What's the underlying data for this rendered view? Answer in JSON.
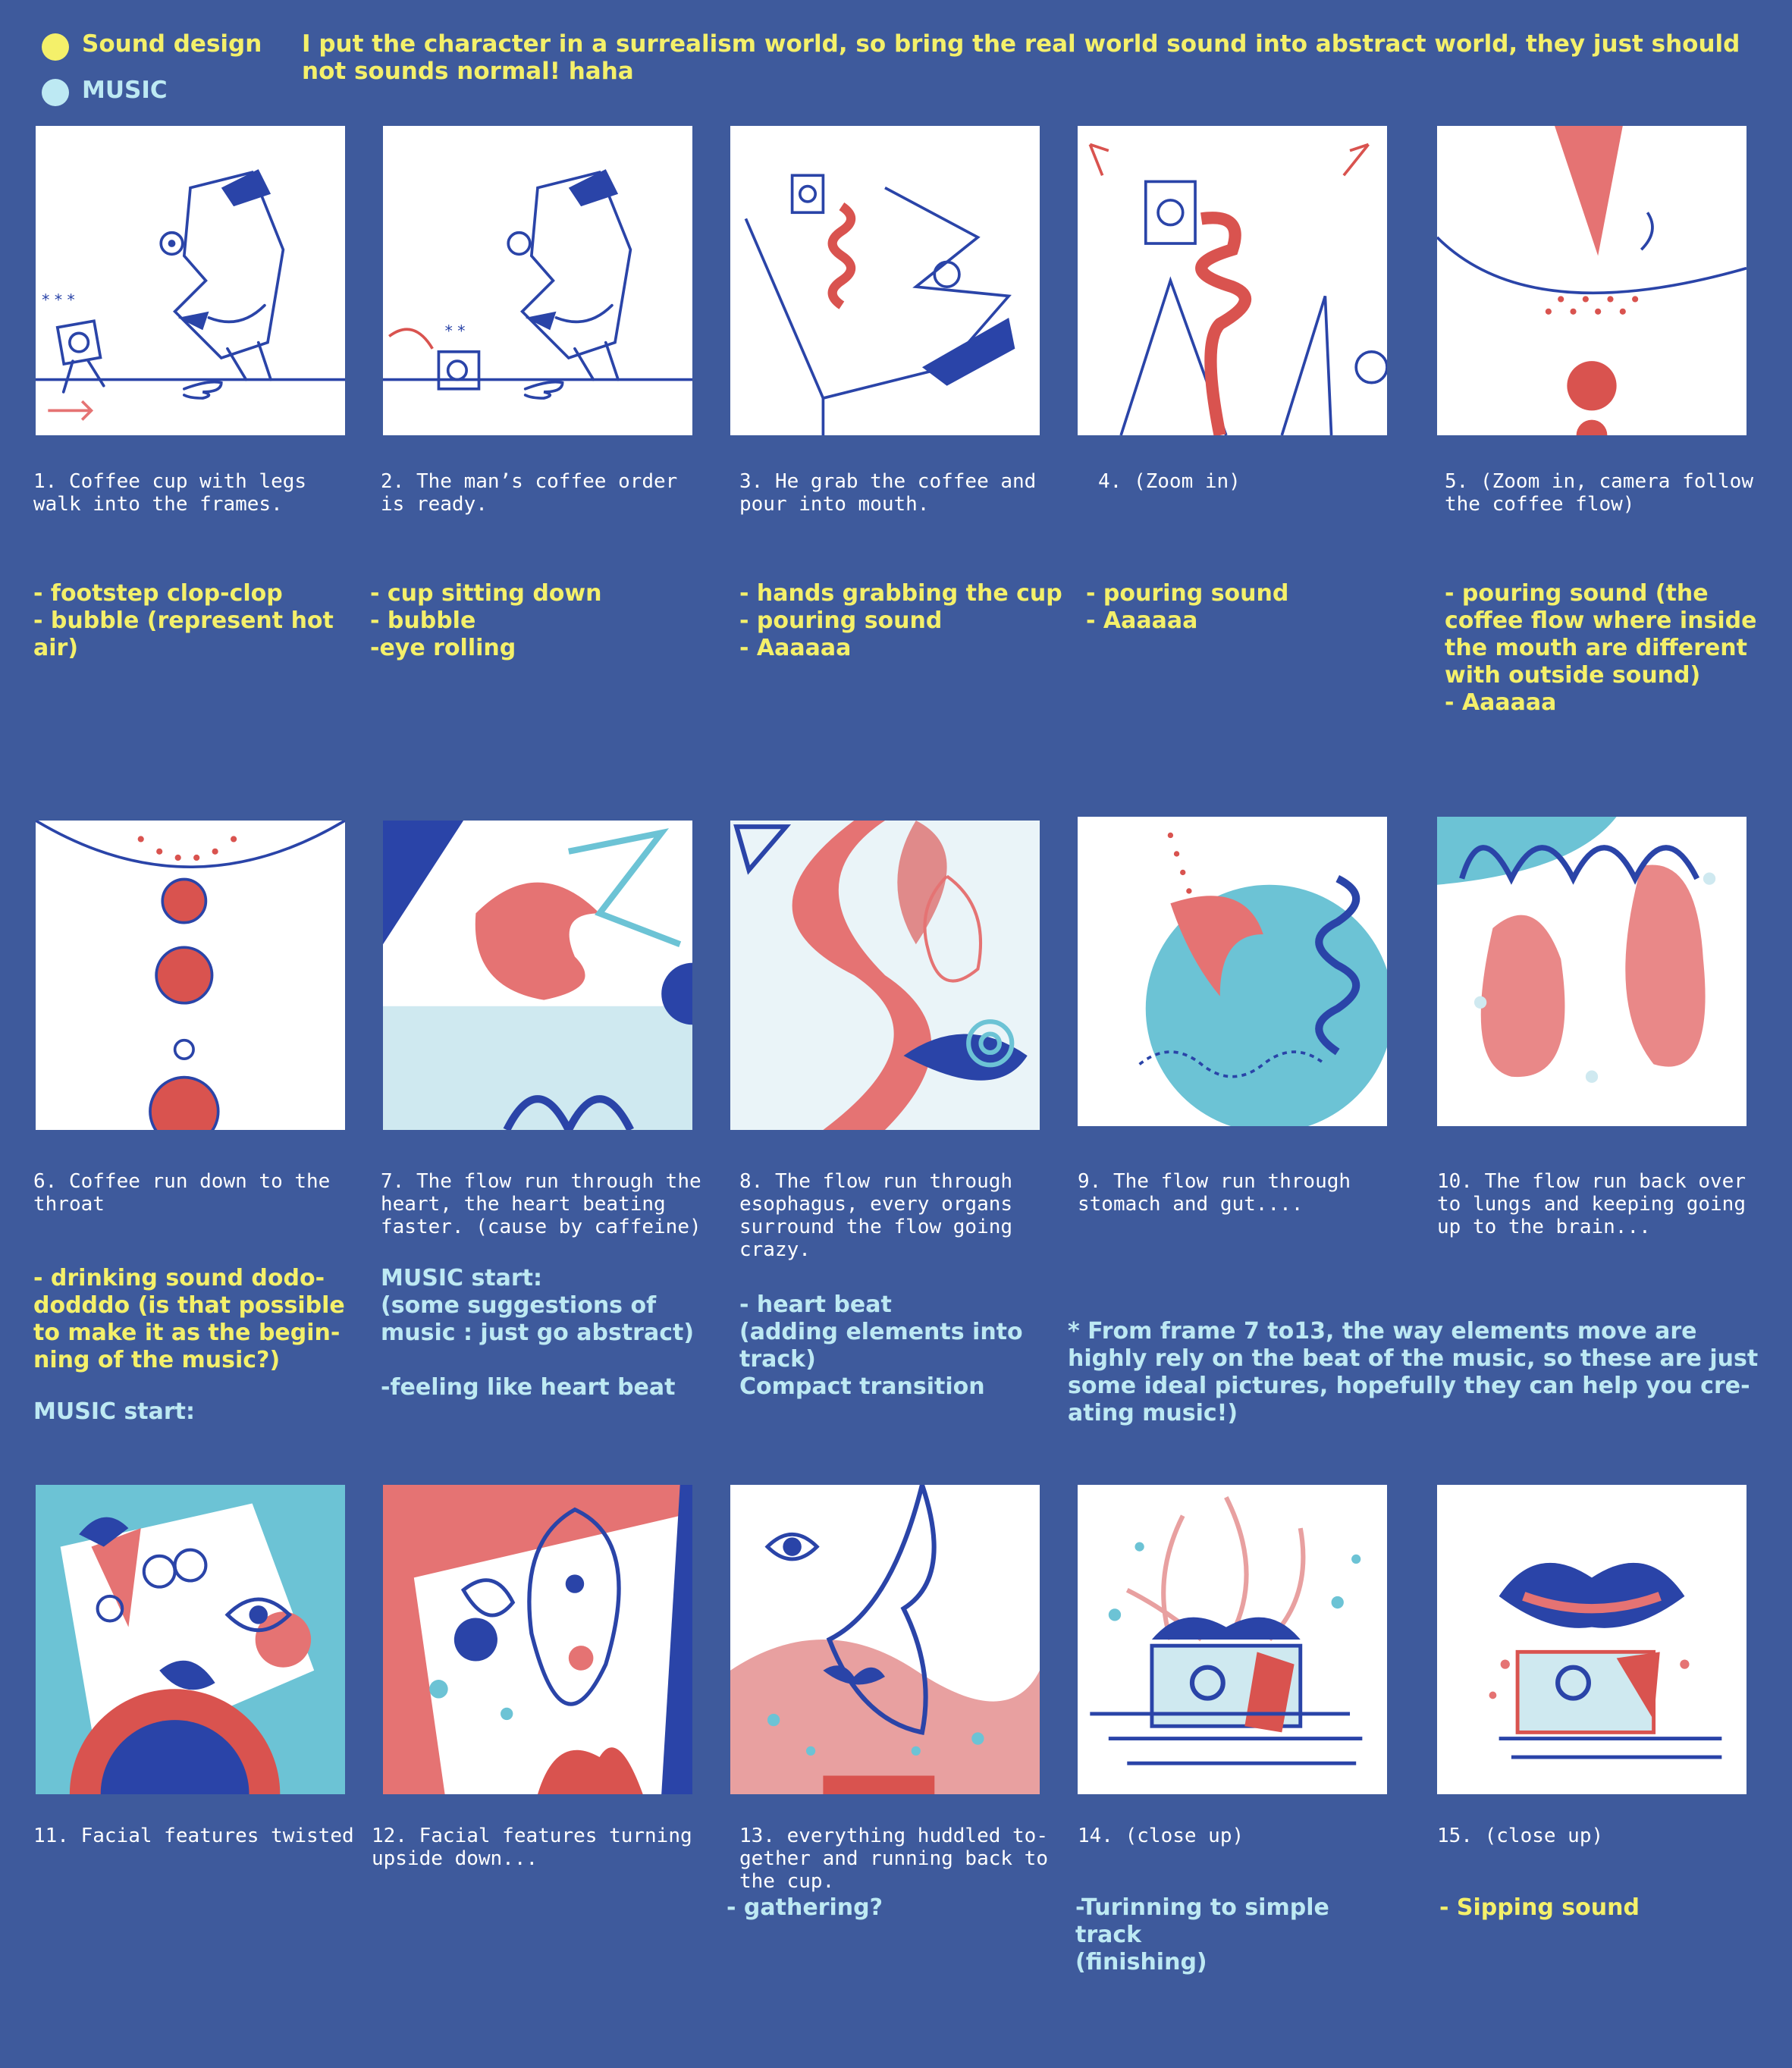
{
  "legend": [
    {
      "label": "Sound design",
      "color": "#f4f06a"
    },
    {
      "label": "MUSIC",
      "color": "#bde9f3"
    }
  ],
  "intro": "I put the character in a surrealism world, so bring the real world sound into abstract world,  they just  should not sounds normal! haha",
  "frames": [
    {
      "caption": "1. Coffee cup with legs\nwalk into the frames.",
      "notes": "- footstep clop-clop\n- bubble (represent hot\nair)",
      "note_color": "#f4f06a"
    },
    {
      "caption": "2.  The man’s coffee order\nis ready.",
      "notes": "- cup sitting down\n- bubble\n-eye rolling",
      "note_color": "#f4f06a"
    },
    {
      "caption": "3. He grab the coffee and\npour into mouth.",
      "notes": "- hands grabbing the cup\n- pouring sound\n- Aaaaaa",
      "note_color": "#f4f06a"
    },
    {
      "caption": "4. (Zoom in)",
      "notes": "- pouring sound\n- Aaaaaa",
      "note_color": "#f4f06a"
    },
    {
      "caption": "5. (Zoom in, camera follow\nthe coffee flow)",
      "notes": "- pouring sound (the\ncoffee flow where inside\nthe mouth are different\nwith outside sound)\n- Aaaaaa",
      "note_color": "#f4f06a"
    },
    {
      "caption": "6. Coffee run down to the\nthroat",
      "notes": "- drinking sound dodo-\ndodddo (is that possible\nto make it as the begin-\nning of the music?)",
      "note_color": "#f4f06a",
      "music": "MUSIC start:"
    },
    {
      "caption": "7. The flow run through the\nheart, the heart beating\nfaster. (cause by caffeine)",
      "notes": "MUSIC start:\n(some suggestions of\nmusic : just go abstract)\n\n-feeling like heart beat",
      "note_color": "#bde9f3"
    },
    {
      "caption": "8. The flow run through\nesophagus, every organs\nsurround the flow going\ncrazy.",
      "notes": "- heart beat\n(adding elements into\ntrack)\nCompact transition",
      "note_color": "#bde9f3"
    },
    {
      "caption": "9. The flow run through\nstomach and gut....",
      "notes": "",
      "note_color": "#bde9f3"
    },
    {
      "caption": "10. The flow run back over\nto lungs and keeping going\nup to the brain...",
      "notes": "",
      "note_color": "#bde9f3"
    },
    {
      "caption": "11. Facial features twisted",
      "notes": "",
      "note_color": "#bde9f3"
    },
    {
      "caption": "12. Facial features turning\nupside down...",
      "notes": "",
      "note_color": "#bde9f3"
    },
    {
      "caption": "13. everything huddled to-\ngether and running back to\nthe cup.",
      "notes": "- gathering?",
      "note_color": "#bde9f3"
    },
    {
      "caption": "14. (close up)",
      "notes": "-Turinning to simple\ntrack\n (finishing)",
      "note_color": "#bde9f3"
    },
    {
      "caption": "15. (close up)",
      "notes": "- Sipping sound",
      "note_color": "#f4f06a"
    }
  ],
  "beat_note": "* From frame 7 to13, the way elements move are\nhighly rely on the beat of the music,  so these are just\nsome ideal pictures, hopefully they can help you cre-\nating music!)",
  "palette": {
    "background": "#3e5a9c",
    "ink": "#2a44a8",
    "coral": "#e57373",
    "red": "#d9534f",
    "aqua": "#6cc3d5",
    "sound": "#f4f06a",
    "music": "#bde9f3"
  }
}
